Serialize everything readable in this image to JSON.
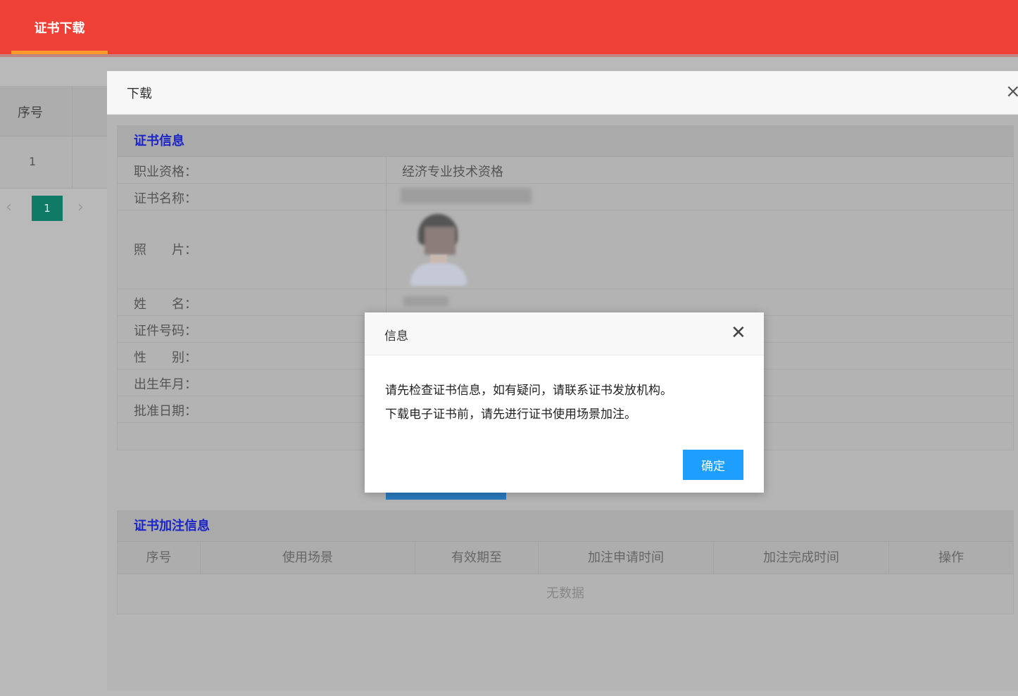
{
  "header": {
    "tab_label": "证书下载",
    "color": "#ee4036"
  },
  "background_table": {
    "col_index": "序号",
    "row_index": "1"
  },
  "pager": {
    "prev_icon": "chevron-left-icon",
    "current_page": "1",
    "next_icon": "chevron-right-icon",
    "page_color": "#0f7a66"
  },
  "download_modal": {
    "title": "下载",
    "close_icon": "×",
    "cert_section": {
      "title": "证书信息",
      "rows": [
        {
          "label": "职业资格：",
          "value": "经济专业技术资格"
        },
        {
          "label": "证书名称：",
          "value": ""
        },
        {
          "label": "照　　片：",
          "value": ""
        },
        {
          "label": "姓　　名：",
          "value": ""
        },
        {
          "label": "证件号码：",
          "value": ""
        },
        {
          "label": "性　　别：",
          "value": ""
        },
        {
          "label": "出生年月：",
          "value": ""
        },
        {
          "label": "批准日期：",
          "value": ""
        }
      ]
    },
    "annotation_section": {
      "title": "证书加注信息",
      "columns": [
        "序号",
        "使用场景",
        "有效期至",
        "加注申请时间",
        "加注完成时间",
        "操作"
      ],
      "empty_text": "无数据"
    }
  },
  "info_dialog": {
    "title": "信息",
    "close_icon": "✕",
    "message_lines": [
      "请先检查证书信息，如有疑问，请联系证书发放机构。",
      "下载电子证书前，请先进行证书使用场景加注。"
    ],
    "ok_label": "确定",
    "ok_color": "#1e9fff"
  }
}
